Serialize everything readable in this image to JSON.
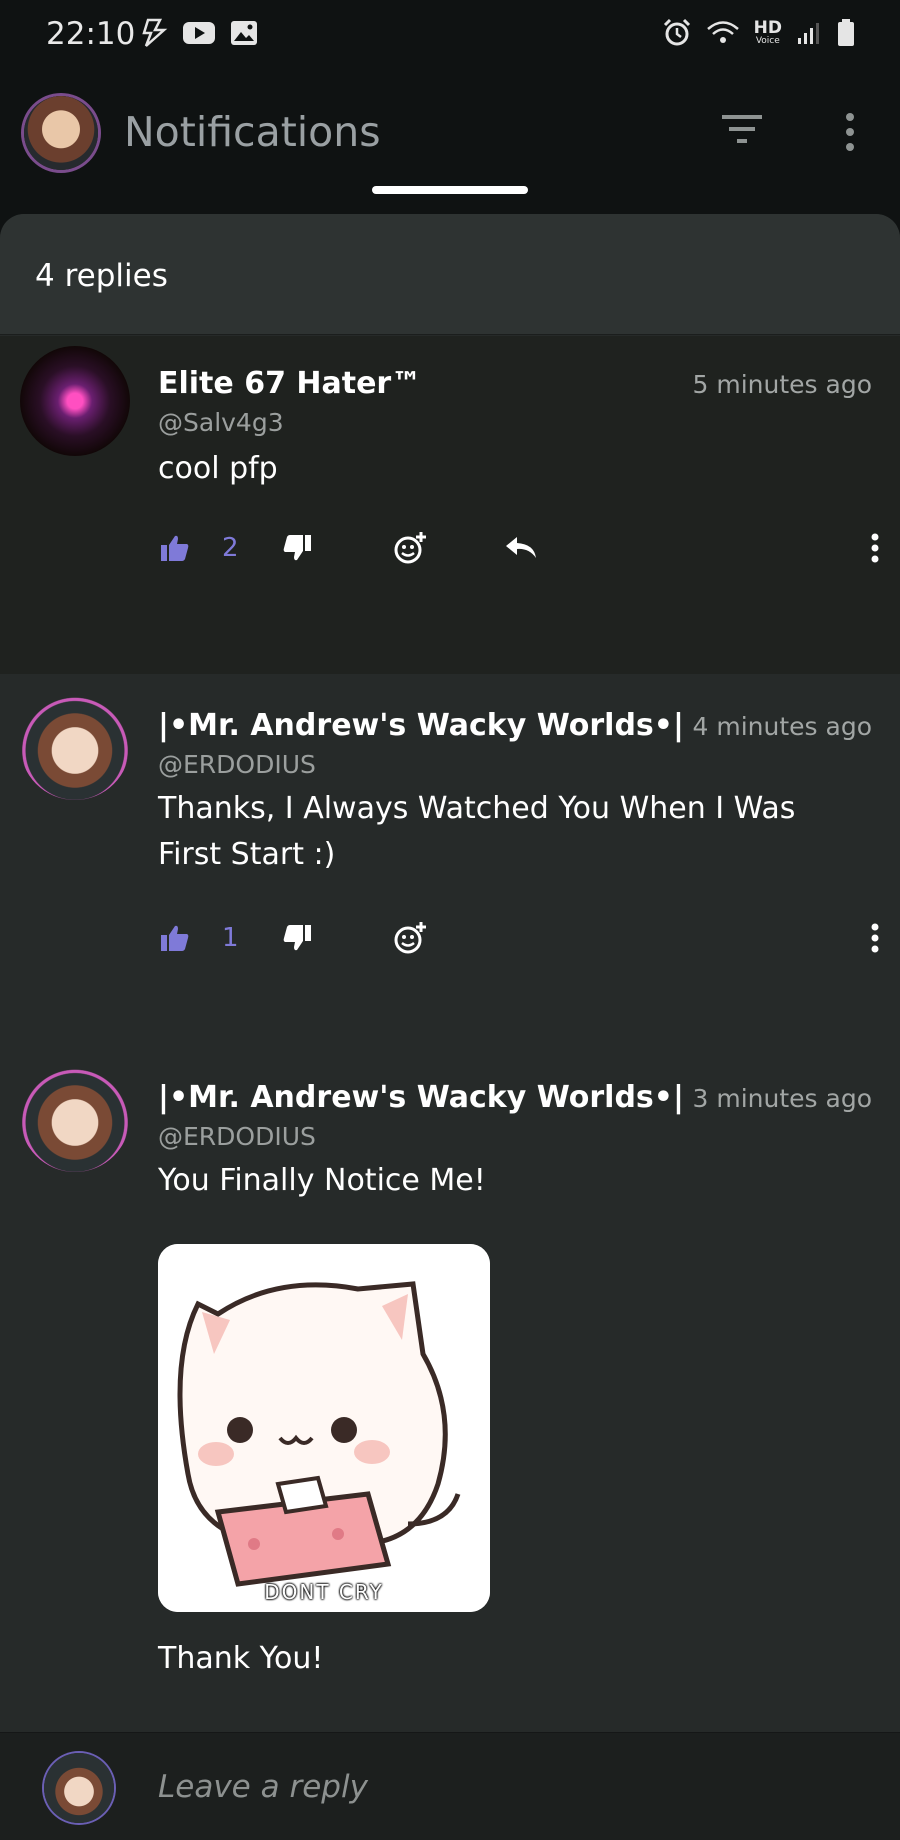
{
  "status_bar": {
    "time": "22:10",
    "icons_left": [
      "flash-icon",
      "youtube-icon",
      "image-icon"
    ],
    "icons_right": [
      "alarm-icon",
      "wifi-icon",
      "hd-voice-icon",
      "signal-icon",
      "battery-icon"
    ],
    "hd_label": "HD",
    "voice_label": "Voice"
  },
  "app_bar": {
    "title": "Notifications"
  },
  "sheet": {
    "header": "4 replies"
  },
  "comments": [
    {
      "name": "Elite 67 Hater™",
      "handle": "@Salv4g3",
      "time": "5 minutes ago",
      "text": "cool pfp",
      "likes": "2",
      "has_reply_button": true
    },
    {
      "name": "|•Mr. Andrew's Wacky Worlds•|F",
      "handle": "@ERDODIUS",
      "time": "4 minutes ago",
      "text": "Thanks, I Always Watched You When I Was First Start :)",
      "likes": "1",
      "has_reply_button": false
    },
    {
      "name": "|•Mr. Andrew's Wacky Worlds•|F",
      "handle": "@ERDODIUS",
      "time": "3 minutes ago",
      "text": "You Finally Notice Me!",
      "sticker_caption": "DONT CRY",
      "text_after": "Thank You!"
    }
  ],
  "footer": {
    "placeholder": "Leave a reply"
  },
  "colors": {
    "background": "#0f1212",
    "sheet": "#262a29",
    "highlight": "#1f221f",
    "accent_like": "#7f7ad8"
  }
}
